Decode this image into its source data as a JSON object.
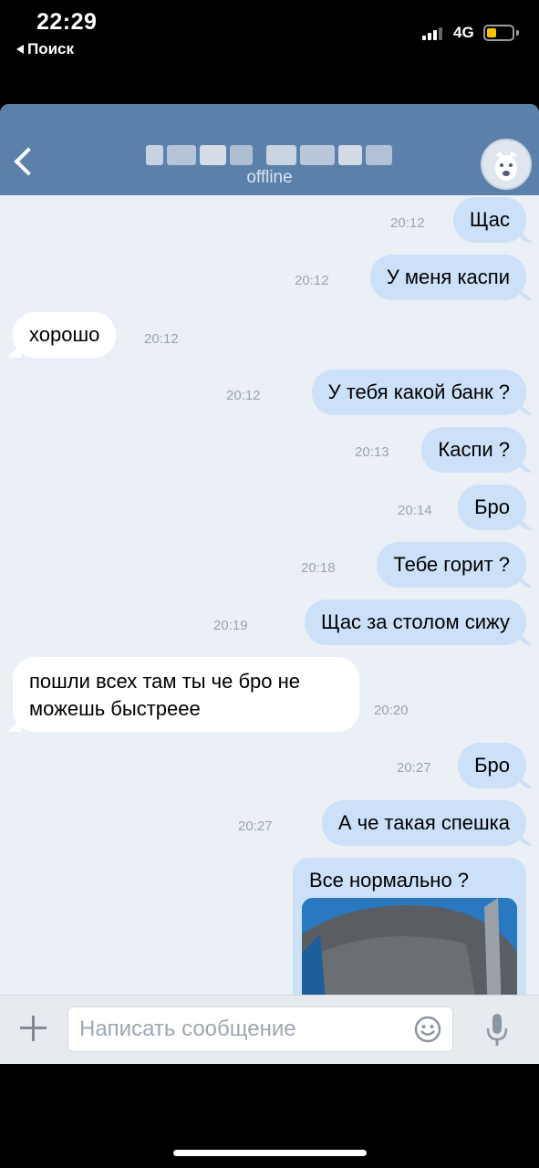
{
  "status_bar": {
    "time": "22:29",
    "back_app": "Поиск",
    "network": "4G",
    "battery_level": 0.4,
    "battery_color": "#f5c400"
  },
  "header": {
    "status": "offline",
    "back_icon": "chevron-left-icon",
    "avatar_icon": "default-dog-avatar-icon",
    "background": "#5b81ab"
  },
  "messages": [
    {
      "dir": "out",
      "text": "Щас",
      "time": "20:12"
    },
    {
      "dir": "out",
      "text": "У меня каспи",
      "time": "20:12"
    },
    {
      "dir": "in",
      "text": "хорошо",
      "time": "20:12"
    },
    {
      "dir": "out",
      "text": "У тебя какой банк ?",
      "time": "20:12"
    },
    {
      "dir": "out",
      "text": "Каспи ?",
      "time": "20:13"
    },
    {
      "dir": "out",
      "text": "Бро",
      "time": "20:14"
    },
    {
      "dir": "out",
      "text": "Тебе горит ?",
      "time": "20:18"
    },
    {
      "dir": "out",
      "text": "Щас за столом сижу",
      "time": "20:19"
    },
    {
      "dir": "in",
      "text_line1": "пошли всех там ты че бро не",
      "text_line2": "можешь быстреее",
      "time": "20:20"
    },
    {
      "dir": "out",
      "text": "Бро",
      "time": "20:27"
    },
    {
      "dir": "out",
      "text": "А че такая спешка",
      "time": "20:27"
    },
    {
      "dir": "out",
      "text": "Все нормально ?",
      "has_photo": true
    }
  ],
  "composer": {
    "placeholder": "Написать сообщение",
    "value": "",
    "attach_icon": "plus-icon",
    "emoji_icon": "smiley-icon",
    "mic_icon": "microphone-icon"
  }
}
